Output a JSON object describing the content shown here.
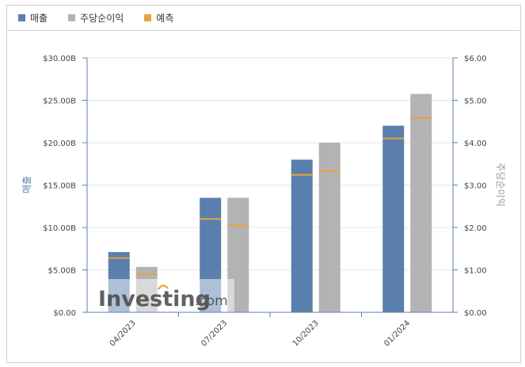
{
  "legend": [
    {
      "label": "매출",
      "color": "#5b7fac"
    },
    {
      "label": "주당순이익",
      "color": "#b3b3b3"
    },
    {
      "label": "예측",
      "color": "#e8a33d"
    }
  ],
  "watermark": {
    "brand": "Investing",
    "suffix": ".com"
  },
  "chart_data": {
    "type": "bar",
    "categories": [
      "04/2023",
      "07/2023",
      "10/2023",
      "01/2024"
    ],
    "y_left": {
      "label": "매출",
      "ticks": [
        "$0.00",
        "$5.00B",
        "$10.00B",
        "$15.00B",
        "$20.00B",
        "$25.00B",
        "$30.00B"
      ],
      "lim": [
        0,
        30
      ]
    },
    "y_right": {
      "label": "주당순이익",
      "ticks": [
        "$0.00",
        "$1.00",
        "$2.00",
        "$3.00",
        "$4.00",
        "$5.00",
        "$6.00"
      ],
      "lim": [
        0,
        6
      ]
    },
    "series": [
      {
        "name": "매출",
        "axis": "left",
        "values": [
          7.1,
          13.5,
          18.0,
          22.0
        ],
        "forecast": [
          6.4,
          11.0,
          16.2,
          20.5
        ],
        "color": "#5b7fac"
      },
      {
        "name": "주당순이익",
        "axis": "right",
        "values": [
          1.07,
          2.7,
          4.0,
          5.15
        ],
        "forecast": [
          0.9,
          2.05,
          3.33,
          4.58
        ],
        "color": "#b3b3b3"
      }
    ],
    "forecast_color": "#e8a33d",
    "grid": true,
    "legend_position": "top-left"
  }
}
